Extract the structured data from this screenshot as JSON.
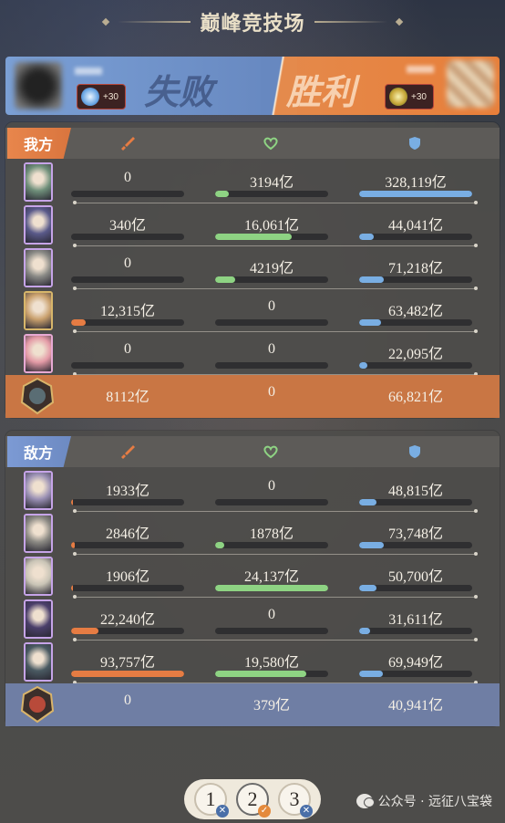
{
  "title": "巅峰竞技场",
  "banner": {
    "left_result": "失败",
    "right_result": "胜利",
    "left_points": "+30",
    "right_points": "+30"
  },
  "ours": {
    "team_label": "我方",
    "rows": [
      {
        "atk": "0",
        "atk_pct": 0,
        "heal": "3194亿",
        "heal_pct": 12,
        "def": "328,119亿",
        "def_pct": 100,
        "frame": "purple",
        "face": "#6f8f7a"
      },
      {
        "atk": "340亿",
        "atk_pct": 0,
        "heal": "16,061亿",
        "heal_pct": 68,
        "def": "44,041亿",
        "def_pct": 13,
        "frame": "purple",
        "face": "#5a5a8a"
      },
      {
        "atk": "0",
        "atk_pct": 0,
        "heal": "4219亿",
        "heal_pct": 18,
        "def": "71,218亿",
        "def_pct": 22,
        "frame": "purple",
        "face": "#8a8a86"
      },
      {
        "atk": "12,315亿",
        "atk_pct": 13,
        "heal": "0",
        "heal_pct": 0,
        "def": "63,482亿",
        "def_pct": 19,
        "frame": "gold",
        "face": "#c9a06d"
      },
      {
        "atk": "0",
        "atk_pct": 0,
        "heal": "0",
        "heal_pct": 0,
        "def": "22,095亿",
        "def_pct": 7,
        "frame": "pink",
        "face": "#e39aa6"
      }
    ],
    "pet": {
      "atk": "8112亿",
      "heal": "0",
      "def": "66,821亿"
    }
  },
  "enemy": {
    "team_label": "敌方",
    "rows": [
      {
        "atk": "1933亿",
        "atk_pct": 2,
        "heal": "0",
        "heal_pct": 0,
        "def": "48,815亿",
        "def_pct": 15,
        "frame": "purple",
        "face": "#9a90b4"
      },
      {
        "atk": "2846亿",
        "atk_pct": 3,
        "heal": "1878亿",
        "heal_pct": 8,
        "def": "73,748亿",
        "def_pct": 22,
        "frame": "purple",
        "face": "#8c8a84"
      },
      {
        "atk": "1906亿",
        "atk_pct": 2,
        "heal": "24,137亿",
        "heal_pct": 100,
        "def": "50,700亿",
        "def_pct": 15,
        "frame": "purple",
        "face": "#c9c4b6"
      },
      {
        "atk": "22,240亿",
        "atk_pct": 24,
        "heal": "0",
        "heal_pct": 0,
        "def": "31,611亿",
        "def_pct": 10,
        "frame": "purple",
        "face": "#4b3f6b"
      },
      {
        "atk": "93,757亿",
        "atk_pct": 100,
        "heal": "19,580亿",
        "heal_pct": 81,
        "def": "69,949亿",
        "def_pct": 21,
        "frame": "purple",
        "face": "#4a5a62"
      }
    ],
    "pet": {
      "atk": "0",
      "heal": "379亿",
      "def": "40,941亿"
    }
  },
  "pager": {
    "pages": [
      {
        "label": "1",
        "status": "lose",
        "mark": "✕"
      },
      {
        "label": "2",
        "status": "win",
        "mark": "✓"
      },
      {
        "label": "3",
        "status": "lose",
        "mark": "✕"
      }
    ],
    "active_index": 1
  },
  "watermark": "公众号 · 远征八宝袋",
  "colors": {
    "ours_accent": "#e8864c",
    "enemy_accent": "#7c9ad4",
    "atk_bar": "#e67c43",
    "heal_bar": "#8ed383",
    "def_bar": "#79aee3"
  },
  "icons": {
    "atk": "sword-icon",
    "heal": "heart-icon",
    "def": "shield-icon"
  }
}
